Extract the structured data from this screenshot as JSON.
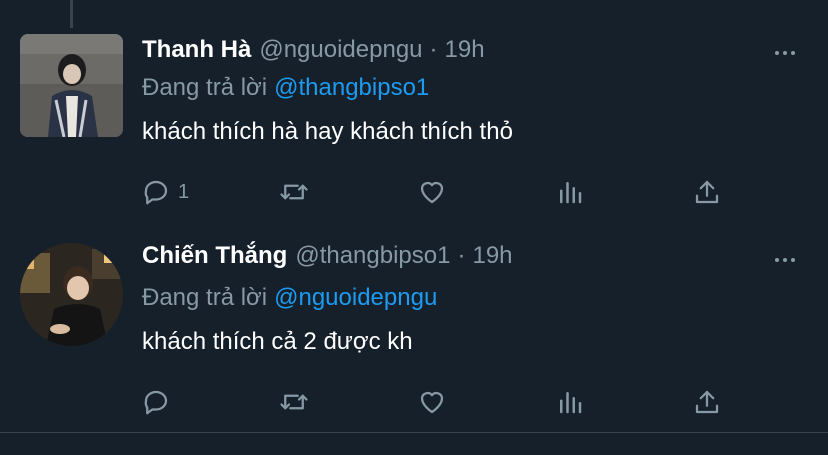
{
  "tweets": [
    {
      "name": "Thanh Hà",
      "handle": "@nguoidepngu",
      "separator": "·",
      "time": "19h",
      "replying_prefix": "Đang trả lời",
      "replying_to": "@thangbipso1",
      "text": "khách thích hà hay khách thích thỏ",
      "reply_count": "1",
      "retweet_count": "",
      "like_count": ""
    },
    {
      "name": "Chiến Thắng",
      "handle": "@thangbipso1",
      "separator": "·",
      "time": "19h",
      "replying_prefix": "Đang trả lời",
      "replying_to": "@nguoidepngu",
      "text": "khách thích cả 2 được kh",
      "reply_count": "",
      "retweet_count": "",
      "like_count": ""
    }
  ],
  "icons": {
    "reply": "reply-icon",
    "retweet": "retweet-icon",
    "like": "heart-icon",
    "analytics": "analytics-icon",
    "share": "share-icon",
    "more": "more-dots-icon"
  },
  "colors": {
    "background": "#15202b",
    "muted_text": "#8899a6",
    "link": "#1d9bf0",
    "divider": "#38444d"
  }
}
